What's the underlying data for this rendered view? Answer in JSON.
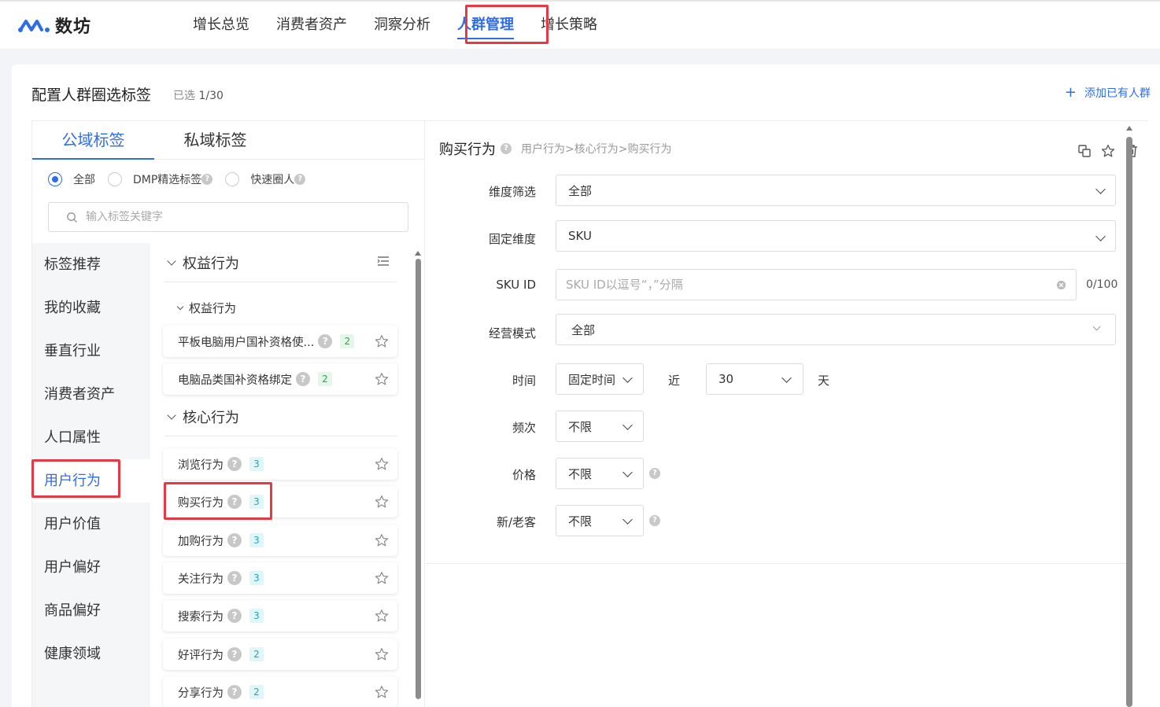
{
  "app": {
    "logo_text": "数坊"
  },
  "nav": {
    "items": [
      "增长总览",
      "消费者资产",
      "洞察分析",
      "人群管理",
      "增长策略"
    ],
    "active_index": 3
  },
  "panel": {
    "title": "配置人群圈选标签",
    "selected_label": "已选",
    "selected_count": "1/30",
    "add_existing_label": "添加已有人群"
  },
  "tabs": {
    "items": [
      "公域标签",
      "私域标签"
    ],
    "active_index": 0
  },
  "filters": {
    "options": [
      "全部",
      "DMP精选标签",
      "快速圈人"
    ],
    "selected_index": 0
  },
  "search": {
    "placeholder": "输入标签关键字",
    "value": ""
  },
  "categories": {
    "items": [
      "标签推荐",
      "我的收藏",
      "垂直行业",
      "消费者资产",
      "人口属性",
      "用户行为",
      "用户价值",
      "用户偏好",
      "商品偏好",
      "健康领域"
    ],
    "active_index": 5
  },
  "tag_groups": [
    {
      "title": "权益行为",
      "sub_title": "权益行为",
      "tags": [
        {
          "name": "平板电脑用户国补资格使...",
          "count": "2"
        },
        {
          "name": "电脑品类国补资格绑定",
          "count": "2"
        }
      ]
    },
    {
      "title": "核心行为",
      "tags": [
        {
          "name": "浏览行为",
          "count": "3"
        },
        {
          "name": "购买行为",
          "count": "3"
        },
        {
          "name": "加购行为",
          "count": "3"
        },
        {
          "name": "关注行为",
          "count": "3"
        },
        {
          "name": "搜索行为",
          "count": "3"
        },
        {
          "name": "好评行为",
          "count": "2"
        },
        {
          "name": "分享行为",
          "count": "2"
        }
      ]
    }
  ],
  "detail": {
    "title": "购买行为",
    "path": "用户行为>核心行为>购买行为",
    "fields": {
      "dimension_filter": {
        "label": "维度筛选",
        "value": "全部"
      },
      "fixed_dimension": {
        "label": "固定维度",
        "value": "SKU"
      },
      "sku_id": {
        "label": "SKU ID",
        "placeholder": "SKU ID以逗号“，”分隔",
        "counter": "0/100"
      },
      "business_mode": {
        "label": "经营模式",
        "value": "全部"
      },
      "time": {
        "label": "时间",
        "mode": "固定时间",
        "near": "近",
        "days": "30",
        "unit": "天"
      },
      "frequency": {
        "label": "频次",
        "value": "不限"
      },
      "price": {
        "label": "价格",
        "value": "不限"
      },
      "customer_type": {
        "label": "新/老客",
        "value": "不限"
      }
    }
  },
  "colors": {
    "accent": "#2f6de6",
    "highlight": "#e63946"
  }
}
